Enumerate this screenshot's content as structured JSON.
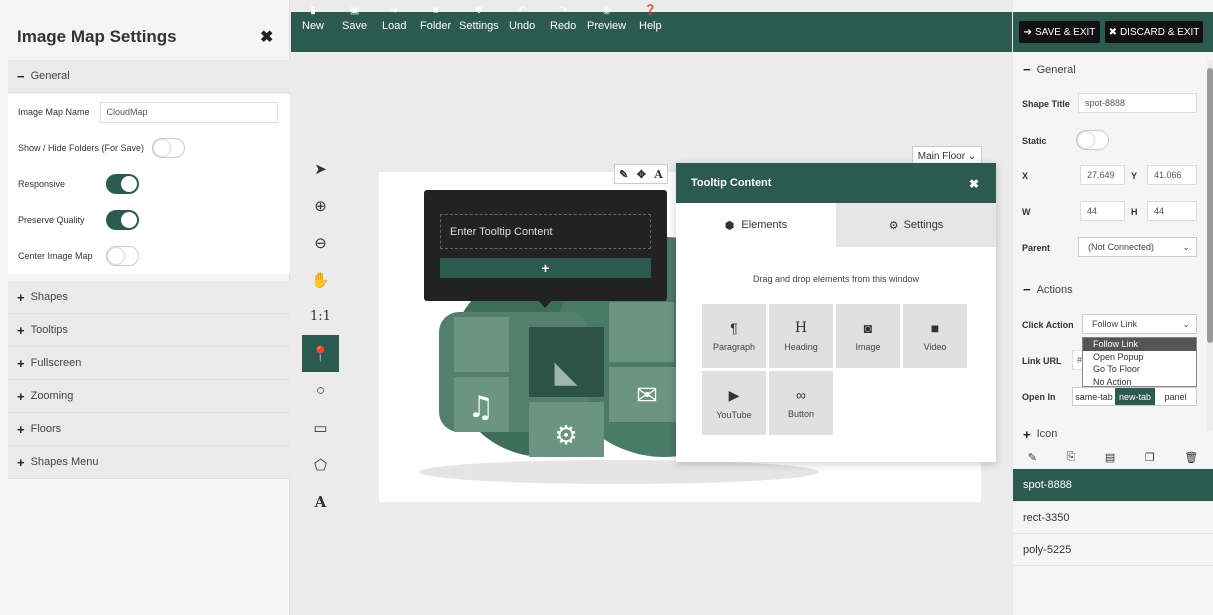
{
  "left_panel": {
    "title": "Image Map Settings",
    "close_icon": "✖",
    "general_label": "General",
    "rows": {
      "map_name_label": "Image Map Name",
      "map_name_value": "CloudMap",
      "show_hide_label": "Show / Hide Folders (For Save)",
      "responsive_label": "Responsive",
      "preserve_label": "Preserve Quality",
      "center_label": "Center Image Map"
    },
    "toggles": {
      "show_hide": false,
      "responsive": true,
      "preserve": true,
      "center": false
    },
    "sections": [
      "Shapes",
      "Tooltips",
      "Fullscreen",
      "Zooming",
      "Floors",
      "Shapes Menu"
    ]
  },
  "toolbar": {
    "items": [
      {
        "label": "New",
        "icon": "📄",
        "icon_name": "new-file-icon"
      },
      {
        "label": "Save",
        "icon": "💾",
        "icon_name": "save-icon"
      },
      {
        "label": "Load",
        "icon": "➜",
        "icon_name": "load-icon"
      },
      {
        "label": "Folder",
        "icon": "■",
        "icon_name": "folder-icon"
      },
      {
        "label": "Settings",
        "icon": "⚙",
        "icon_name": "settings-icon"
      },
      {
        "label": "Undo",
        "icon": "↶",
        "icon_name": "undo-icon"
      },
      {
        "label": "Redo",
        "icon": "↷",
        "icon_name": "redo-icon"
      },
      {
        "label": "Preview",
        "icon": "◉",
        "icon_name": "preview-icon"
      },
      {
        "label": "Help",
        "icon": "?",
        "icon_name": "help-icon"
      }
    ]
  },
  "canvas": {
    "floor_select": "Main Floor",
    "tools": [
      {
        "glyph": "➤",
        "name": "select-tool-icon"
      },
      {
        "glyph": "⊕",
        "name": "zoom-in-icon"
      },
      {
        "glyph": "⊖",
        "name": "zoom-out-icon"
      },
      {
        "glyph": "✋",
        "name": "pan-hand-icon"
      },
      {
        "glyph": "1:1",
        "name": "reset-zoom-icon"
      },
      {
        "glyph": "⬤",
        "name": "spot-tool-icon"
      },
      {
        "glyph": "○",
        "name": "oval-tool-icon"
      },
      {
        "glyph": "▭",
        "name": "rect-tool-icon"
      },
      {
        "glyph": "⬠",
        "name": "poly-tool-icon"
      },
      {
        "glyph": "A",
        "name": "text-tool-icon"
      }
    ],
    "mini_toolbar": [
      "✎",
      "✥",
      "A"
    ]
  },
  "tooltip_preview": {
    "placeholder": "Enter Tooltip Content",
    "add_label": "+"
  },
  "tooltip_window": {
    "title": "Tooltip Content",
    "close": "✖",
    "tab_elements": "Elements",
    "tab_settings": "Settings",
    "hint": "Drag and drop elements from this window",
    "elements": [
      {
        "label": "Paragraph",
        "icon": "¶",
        "icon_name": "paragraph-icon"
      },
      {
        "label": "Heading",
        "icon": "H",
        "icon_name": "heading-icon"
      },
      {
        "label": "Image",
        "icon": "◙",
        "icon_name": "camera-icon"
      },
      {
        "label": "Video",
        "icon": "■",
        "icon_name": "video-icon"
      },
      {
        "label": "YouTube",
        "icon": "▶",
        "icon_name": "youtube-icon"
      },
      {
        "label": "Button",
        "icon": "∞",
        "icon_name": "link-icon"
      }
    ]
  },
  "right_panel": {
    "save_exit": "SAVE & EXIT",
    "discard_exit": "DISCARD & EXIT",
    "general_label": "General",
    "shape_title_label": "Shape Title",
    "shape_title_value": "spot-8888",
    "static_label": "Static",
    "x_label": "X",
    "x_value": "27.649",
    "y_label": "Y",
    "y_value": "41.066",
    "w_label": "W",
    "w_value": "44",
    "h_label": "H",
    "h_value": "44",
    "parent_label": "Parent",
    "parent_value": "(Not Connected)",
    "actions_label": "Actions",
    "click_action_label": "Click Action",
    "click_action_value": "Follow Link",
    "dropdown_options": [
      "Follow Link",
      "Open Popup",
      "Go To Floor",
      "No Action"
    ],
    "link_url_label": "Link URL",
    "link_url_value": "#",
    "open_in_label": "Open In",
    "open_in_options": [
      "same-tab",
      "new-tab",
      "panel"
    ],
    "icon_label": "Icon",
    "shapes": [
      "spot-8888",
      "rect-3350",
      "poly-5225"
    ]
  },
  "colors": {
    "brand": "#2c5a51",
    "panel": "#f5f5f5",
    "canvas": "#ebebeb"
  }
}
